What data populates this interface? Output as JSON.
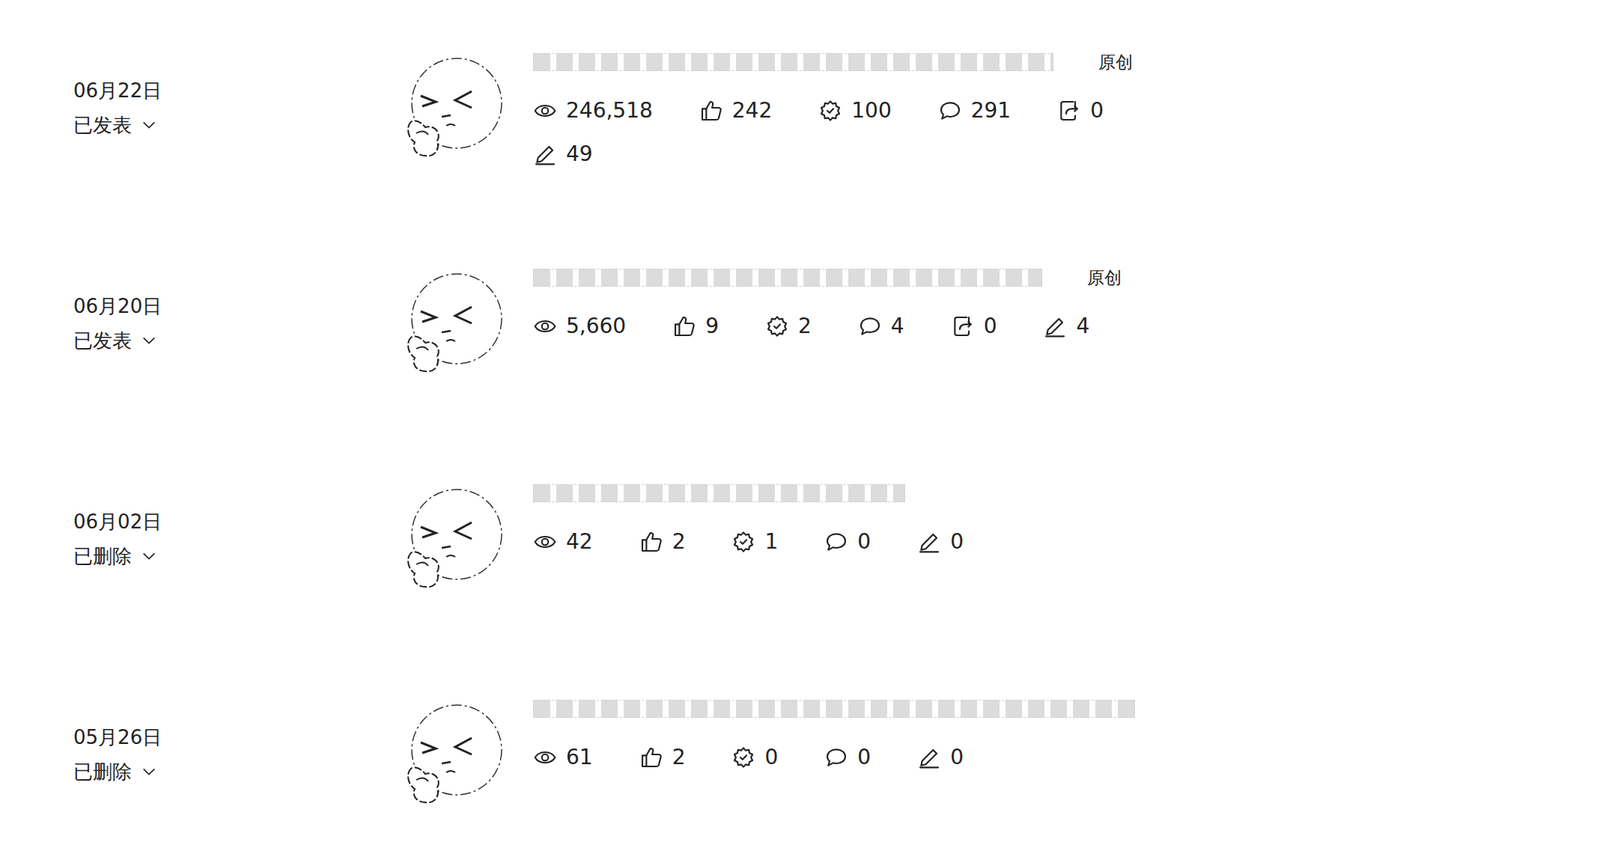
{
  "posts": [
    {
      "date": "06月22日",
      "status": "已发表",
      "original_tag": "原创",
      "stats": [
        {
          "kind": "views",
          "value": "246,518"
        },
        {
          "kind": "likes",
          "value": "242"
        },
        {
          "kind": "recommends",
          "value": "100"
        },
        {
          "kind": "comments",
          "value": "291"
        },
        {
          "kind": "shares",
          "value": "0"
        },
        {
          "kind": "edits",
          "value": "49"
        }
      ]
    },
    {
      "date": "06月20日",
      "status": "已发表",
      "original_tag": "原创",
      "stats": [
        {
          "kind": "views",
          "value": "5,660"
        },
        {
          "kind": "likes",
          "value": "9"
        },
        {
          "kind": "recommends",
          "value": "2"
        },
        {
          "kind": "comments",
          "value": "4"
        },
        {
          "kind": "shares",
          "value": "0"
        },
        {
          "kind": "edits",
          "value": "4"
        }
      ]
    },
    {
      "date": "06月02日",
      "status": "已删除",
      "stats": [
        {
          "kind": "views",
          "value": "42"
        },
        {
          "kind": "likes",
          "value": "2"
        },
        {
          "kind": "recommends",
          "value": "1"
        },
        {
          "kind": "comments",
          "value": "0"
        },
        {
          "kind": "edits",
          "value": "0"
        }
      ]
    },
    {
      "date": "05月26日",
      "status": "已删除",
      "stats": [
        {
          "kind": "views",
          "value": "61"
        },
        {
          "kind": "likes",
          "value": "2"
        },
        {
          "kind": "recommends",
          "value": "0"
        },
        {
          "kind": "comments",
          "value": "0"
        },
        {
          "kind": "edits",
          "value": "0"
        }
      ]
    }
  ]
}
